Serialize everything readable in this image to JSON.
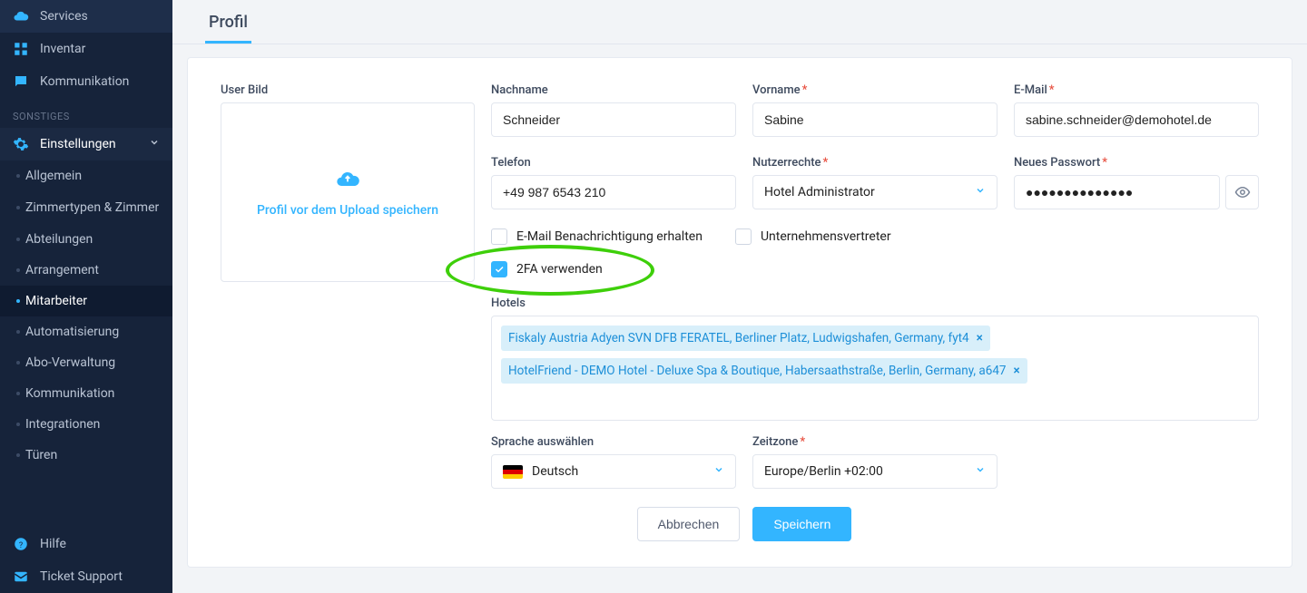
{
  "sidebar": {
    "main_items": [
      {
        "label": "Services",
        "icon": "cloud"
      },
      {
        "label": "Inventar",
        "icon": "grid"
      },
      {
        "label": "Kommunikation",
        "icon": "chat"
      }
    ],
    "section_label": "SONSTIGES",
    "settings": {
      "label": "Einstellungen",
      "icon": "gear"
    },
    "settings_children": [
      {
        "label": "Allgemein"
      },
      {
        "label": "Zimmertypen & Zimmer"
      },
      {
        "label": "Abteilungen"
      },
      {
        "label": "Arrangement"
      },
      {
        "label": "Mitarbeiter",
        "active": true
      },
      {
        "label": "Automatisierung"
      },
      {
        "label": "Abo‑Verwaltung"
      },
      {
        "label": "Kommunikation"
      },
      {
        "label": "Integrationen"
      },
      {
        "label": "Türen"
      }
    ],
    "footer": [
      {
        "label": "Hilfe",
        "icon": "help"
      },
      {
        "label": "Ticket Support",
        "icon": "ticket"
      }
    ]
  },
  "tab": {
    "label": "Profil"
  },
  "form": {
    "user_image": {
      "label": "User Bild",
      "upload_hint": "Profil vor dem Upload speichern"
    },
    "lastname": {
      "label": "Nachname",
      "value": "Schneider"
    },
    "firstname": {
      "label": "Vorname",
      "value": "Sabine"
    },
    "email": {
      "label": "E-Mail",
      "value": "sabine.schneider@demohotel.de"
    },
    "phone": {
      "label": "Telefon",
      "value": "+49 987 6543 210"
    },
    "rights": {
      "label": "Nutzerrechte",
      "value": "Hotel Administrator"
    },
    "password": {
      "label": "Neues Passwort",
      "value": "●●●●●●●●●●●●●●"
    },
    "checks": {
      "email_notify": "E-Mail Benachrichtigung erhalten",
      "company_rep": "Unternehmensvertreter",
      "use_2fa": "2FA verwenden"
    },
    "hotels": {
      "label": "Hotels",
      "tags": [
        "Fiskaly Austria Adyen SVN DFB FERATEL, Berliner Platz, Ludwigshafen, Germany, fyt4",
        "HotelFriend - DEMO Hotel - Deluxe Spa & Boutique, Habersaathstraße, Berlin, Germany, a647"
      ]
    },
    "language": {
      "label": "Sprache auswählen",
      "value": "Deutsch"
    },
    "timezone": {
      "label": "Zeitzone",
      "value": "Europe/Berlin +02:00"
    },
    "actions": {
      "cancel": "Abbrechen",
      "save": "Speichern"
    }
  }
}
